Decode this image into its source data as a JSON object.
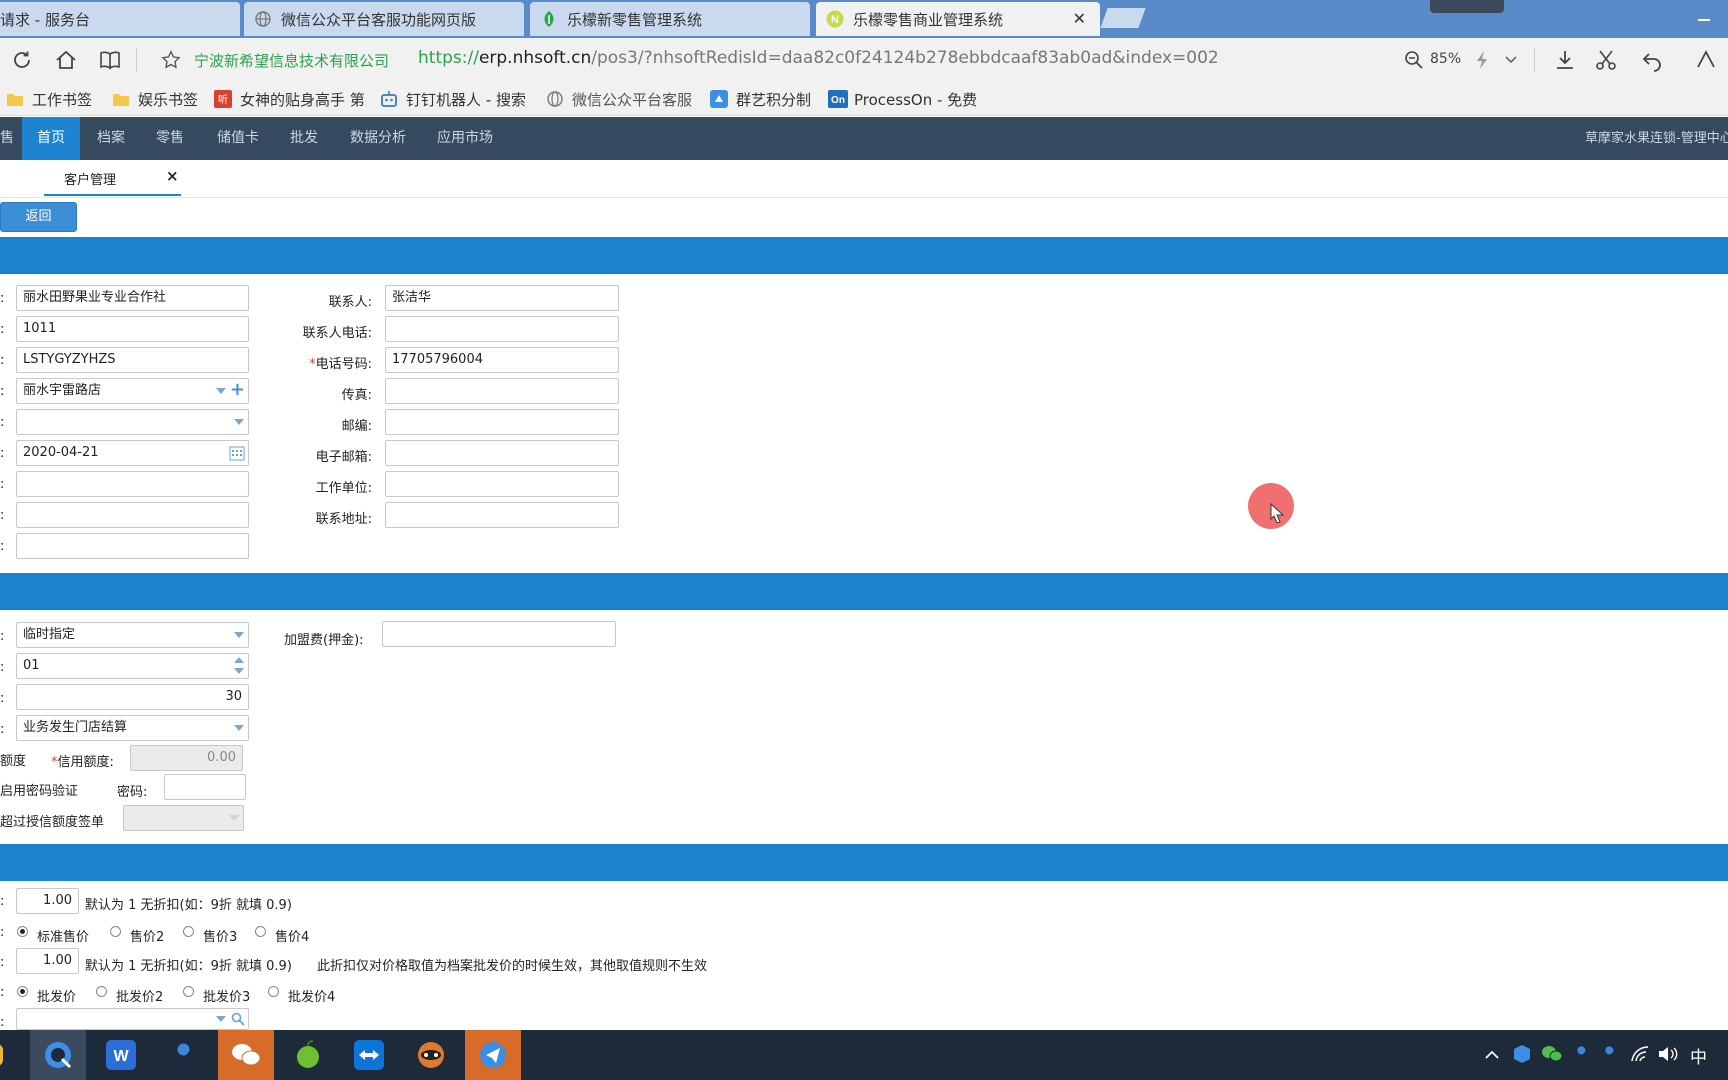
{
  "browser": {
    "tabs": [
      {
        "title": "请求 - 服务台"
      },
      {
        "title": "微信公众平台客服功能网页版"
      },
      {
        "title": "乐檬新零售管理系统"
      },
      {
        "title": "乐檬零售商业管理系统"
      }
    ],
    "close_glyph": "✕",
    "site_name": "宁波新希望信息技术有限公司",
    "url_scheme": "https://",
    "url_host": "erp.nhsoft.cn",
    "url_path": "/pos3/?nhsoftRedisId=daa82c0f24124b278ebbdcaaf83ab0ad&index=002",
    "zoom": "85%",
    "bookmarks": [
      {
        "label": "工作书签",
        "icon": "folder-icon"
      },
      {
        "label": "娱乐书签",
        "icon": "folder-icon"
      },
      {
        "label": "女神的贴身高手 第",
        "icon": "book-app-icon"
      },
      {
        "label": "钉钉机器人 - 搜索",
        "icon": "robot-icon"
      },
      {
        "label": "微信公众平台客服",
        "icon": "globe-icon"
      },
      {
        "label": "群艺积分制",
        "icon": "app-icon"
      },
      {
        "label": "ProcessOn - 免费",
        "icon": "processon-icon"
      }
    ]
  },
  "app": {
    "nav": [
      "售",
      "首页",
      "档案",
      "零售",
      "储值卡",
      "批发",
      "数据分析",
      "应用市场"
    ],
    "user": "草摩家水果连锁-管理中心",
    "page_tab": "客户管理",
    "page_tab_close": "×",
    "back_button": "返回"
  },
  "form1": {
    "left_values": [
      "丽水田野果业专业合作社",
      "1011",
      "LSTYGYZYHZS",
      "丽水宇雷路店",
      "",
      "2020-04-21",
      "",
      "",
      ""
    ],
    "right": [
      {
        "label": "联系人:",
        "value": "张洁华",
        "required": false
      },
      {
        "label": "联系人电话:",
        "value": "",
        "required": false
      },
      {
        "label": "电话号码:",
        "value": "17705796004",
        "required": true
      },
      {
        "label": "传真:",
        "value": "",
        "required": false
      },
      {
        "label": "邮编:",
        "value": "",
        "required": false
      },
      {
        "label": "电子邮箱:",
        "value": "",
        "required": false
      },
      {
        "label": "工作单位:",
        "value": "",
        "required": false
      },
      {
        "label": "联系地址:",
        "value": "",
        "required": false
      }
    ]
  },
  "form2": {
    "settle_type": "临时指定",
    "franchise_label": "加盟费(押金):",
    "franchise_value": "",
    "period": "01",
    "days": "30",
    "settle_store": "业务发生门店结算",
    "credit_check_label": "额度",
    "credit_label": "信用额度:",
    "credit_value": "0.00",
    "pwd_check_label": "启用密码验证",
    "pwd_label": "密码:",
    "over_label": "超过授信额度签单"
  },
  "form3": {
    "discount1": "1.00",
    "discount_hint": "默认为 1 无折扣(如：9折 就填 0.9)",
    "price_options": [
      "标准售价",
      "售价2",
      "售价3",
      "售价4"
    ],
    "discount2": "1.00",
    "discount_hint2": "默认为 1 无折扣(如：9折 就填 0.9)",
    "discount_note": "此折扣仅对价格取值为档案批发价的时候生效，其他取值规则不生效",
    "wholesale_options": [
      "批发价",
      "批发价2",
      "批发价3",
      "批发价4"
    ]
  },
  "taskbar": {
    "ime": "中"
  },
  "colors": {
    "band": "#1b82cf",
    "nav_bg": "#354a5f",
    "nav_active": "#1e84d0",
    "tab_bar": "#5a8bc9",
    "site_green": "#2aa44a"
  }
}
